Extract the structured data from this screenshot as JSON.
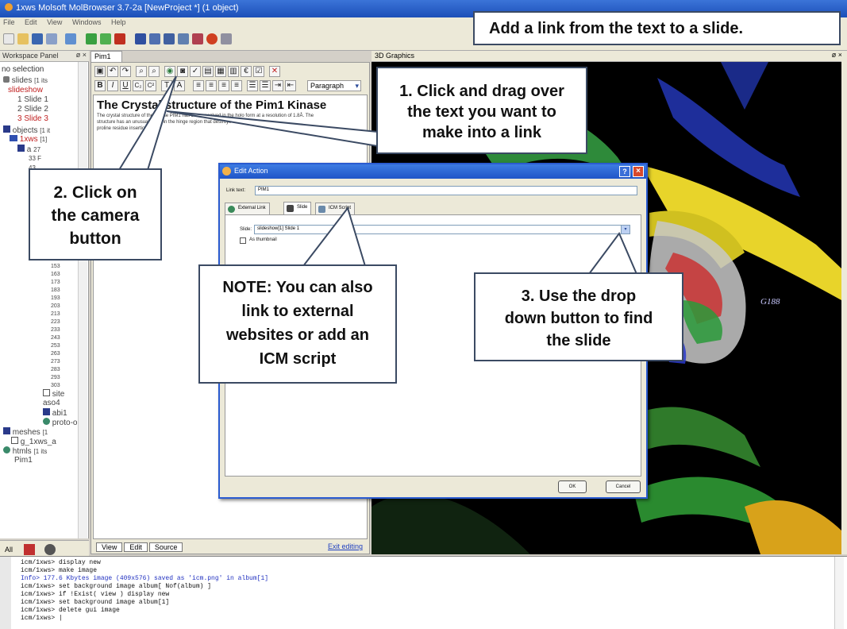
{
  "window": {
    "title": "1xws Molsoft MolBrowser 3.7-2a [NewProject *] (1 object)",
    "menu": [
      "File",
      "Edit",
      "View",
      "Windows",
      "Help"
    ]
  },
  "workspace": {
    "panel_title": "Workspace Panel",
    "panel_controls": "ø ×",
    "selection_text": "no selection",
    "tree": [
      {
        "text": "slides",
        "suffix": "[1 its"
      },
      {
        "text": "slideshow"
      },
      {
        "text": "1 Slide 1"
      },
      {
        "text": "2 Slide 2"
      },
      {
        "text": "3 Slide 3"
      },
      {
        "text": "objects",
        "suffix": "[1 it"
      },
      {
        "text": "1xws",
        "suffix": "[1]"
      },
      {
        "text": "a",
        "suffix": "27"
      },
      {
        "text": "33",
        "suffix": "F"
      },
      {
        "text": "43"
      }
    ],
    "residues": [
      "143",
      "153",
      "163",
      "173",
      "183",
      "193",
      "203",
      "213",
      "223",
      "233",
      "243",
      "253",
      "263",
      "273",
      "283",
      "293",
      "303"
    ],
    "tree_bottom": [
      "site",
      "aso4",
      "abi1",
      "proto-o",
      "meshes",
      "g_1xws_a",
      "htmls",
      "Pim1"
    ],
    "tree_bottom_suffix": {
      "meshes": "[1",
      "htmls": "[1 its"
    },
    "bottom_tabs": [
      "All"
    ]
  },
  "editor": {
    "tab": "Pim1",
    "paragraph_style": "Paragraph",
    "heading": "The Crystal structure of the Pim1 Kinase",
    "body_lines": [
      "The crystal structure of the kinase PIM1 has been resolved in the holo form at a resolution of 1.8Å. The",
      "structure has an unusual bulge in the hinge region that destroys",
      "proline residue insertion."
    ],
    "view_tabs": [
      "View",
      "Edit",
      "Source"
    ],
    "exit_link": "Exit editing"
  },
  "graphics": {
    "panel_title": "3D Graphics",
    "controls": "ø ×",
    "residue_label": "G188"
  },
  "dialog": {
    "title": "Edit Action",
    "help": "?",
    "close": "×",
    "link_text_label": "Link text:",
    "link_text_value": "PIM1",
    "tabs": [
      "External Link",
      "Slide",
      "ICM Script"
    ],
    "active_tab": "Slide",
    "slide_label": "Slide:",
    "slide_value": "slideshow[1] Slide 1",
    "thumbnail_label": "As thumbnail",
    "ok": "OK",
    "cancel": "Cancel"
  },
  "console": {
    "lines": [
      "icm/1xws> display new",
      "icm/1xws> make image",
      " Info> 177.6 Kbytes image (409x576) saved as 'icm.png' in album[1]",
      "icm/1xws> set background image album[ Nof(album) ]",
      "icm/1xws> if !Exist( view ) display new",
      "icm/1xws> set background image album[1]",
      "icm/1xws> delete gui image",
      "icm/1xws> |"
    ]
  },
  "annotations": {
    "banner": "Add a link from the text to a slide.",
    "step1": [
      "1. Click and drag over",
      "the text you want to",
      "make into a link"
    ],
    "step2": [
      "2. Click on",
      "the camera",
      "button"
    ],
    "step3": [
      "3. Use the drop",
      "down button to find",
      "the slide"
    ],
    "note": [
      "NOTE: You can also",
      "link to external",
      "websites or add an",
      "ICM script"
    ]
  }
}
